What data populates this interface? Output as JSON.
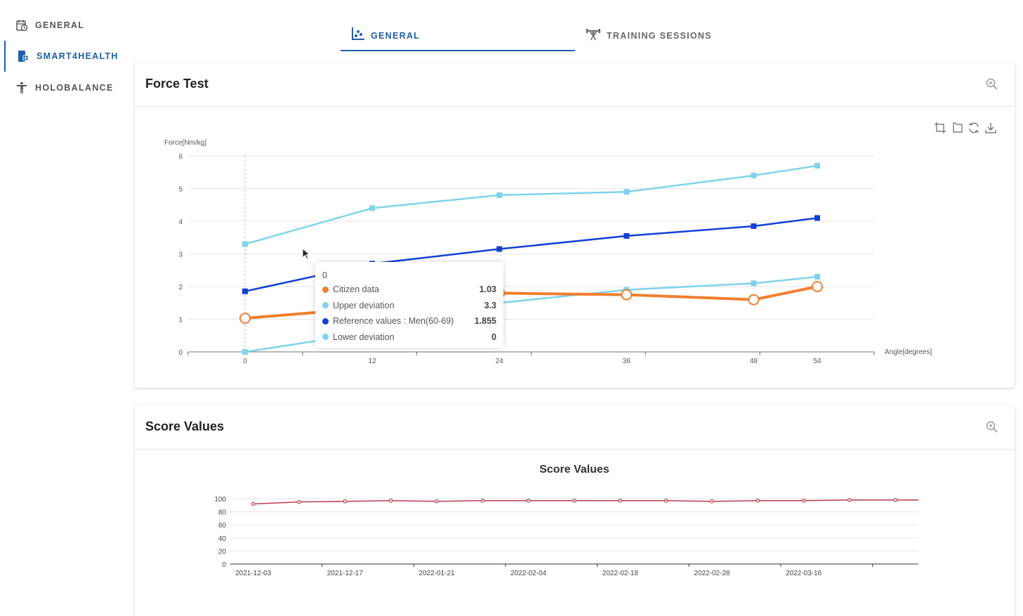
{
  "sidebar": {
    "items": [
      {
        "label": "GENERAL",
        "icon": "calendar-clock-icon"
      },
      {
        "label": "SMART4HEALTH",
        "icon": "phone-health-icon",
        "active": true
      },
      {
        "label": "HOLOBALANCE",
        "icon": "person-standing-icon"
      }
    ]
  },
  "tabs": [
    {
      "label": "GENERAL",
      "icon": "scatter-chart-icon",
      "active": true
    },
    {
      "label": "TRAINING SESSIONS",
      "icon": "weightlifter-icon"
    }
  ],
  "colors": {
    "accent": "#1f5fa8",
    "citizen": "#f07f2e",
    "deviation": "#7fd3ea",
    "reference": "#1240d6",
    "score": "#b83c4e"
  },
  "force_card": {
    "title": "Force Test",
    "toolbox_icons": [
      "zoom-area-icon",
      "zoom-reset-icon",
      "restore-icon",
      "download-icon"
    ]
  },
  "tooltip": {
    "header": "0",
    "rows": [
      {
        "name": "Citizen data",
        "value": "1.03",
        "color": "#f07f2e"
      },
      {
        "name": "Upper deviation",
        "value": "3.3",
        "color": "#7fd3ea"
      },
      {
        "name": "Reference values : Men(60-69)",
        "value": "1.855",
        "color": "#1240d6"
      },
      {
        "name": "Lower deviation",
        "value": "0",
        "color": "#7fd3ea"
      }
    ]
  },
  "score_card": {
    "title": "Score Values"
  },
  "chart_data": [
    {
      "type": "line",
      "ylabel": "Force[Nm/kg]",
      "xlabel": "Angle[degrees]",
      "x": [
        0,
        12,
        24,
        36,
        48,
        54
      ],
      "ylim": [
        0,
        6
      ],
      "yticks": [
        0,
        1,
        2,
        3,
        4,
        5,
        6
      ],
      "grid": true,
      "series": [
        {
          "name": "Upper deviation",
          "values": [
            3.3,
            4.4,
            4.8,
            4.9,
            5.4,
            5.7
          ]
        },
        {
          "name": "Reference values : Men(60-69)",
          "values": [
            1.855,
            2.7,
            3.15,
            3.55,
            3.85,
            4.1
          ]
        },
        {
          "name": "Lower deviation",
          "values": [
            0,
            0.6,
            1.5,
            1.9,
            2.1,
            2.3
          ]
        },
        {
          "name": "Citizen data",
          "values": [
            1.03,
            1.35,
            1.8,
            1.75,
            1.6,
            2.0
          ]
        }
      ]
    },
    {
      "type": "line",
      "title": "Score Values",
      "categories": [
        "2021-12-03",
        "",
        "2021-12-17",
        "",
        "2022-01-21",
        "",
        "2022-02-04",
        "",
        "2022-02-18",
        "",
        "2022-02-28",
        "",
        "2022-03-16",
        "",
        ""
      ],
      "ylim": [
        0,
        100
      ],
      "yticks": [
        0,
        20,
        40,
        60,
        80,
        100
      ],
      "grid": true,
      "series": [
        {
          "values": [
            92,
            95,
            96,
            97,
            96,
            97,
            97,
            97,
            97,
            97,
            96,
            97,
            97,
            98,
            98
          ]
        }
      ]
    }
  ]
}
